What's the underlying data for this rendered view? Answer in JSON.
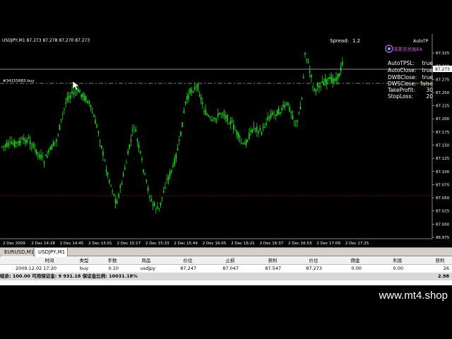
{
  "chart": {
    "symbol_info": "USDJPY,M1  87.273 87.278 87.270 87.273",
    "spread_label": "Spread:",
    "spread_value": "1.2",
    "autotp_label": "AutoTP",
    "logo_text": "浑茶东贸易EA",
    "order_label": "#34155883 buy",
    "current_price": "87.273",
    "price_ticks": [
      "87.325",
      "87.300",
      "87.275",
      "87.250",
      "87.225",
      "87.200",
      "87.175",
      "87.150",
      "87.125",
      "87.100",
      "87.075",
      "87.050",
      "87.025",
      "87.000",
      "86.975"
    ],
    "time_ticks": [
      "2 Dec 2009",
      "2 Dec 14:28",
      "2 Dec 14:45",
      "2 Dec 15:01",
      "2 Dec 15:17",
      "2 Dec 15:33",
      "2 Dec 15:49",
      "2 Dec 16:05",
      "2 Dec 16:21",
      "2 Dec 16:37",
      "2 Dec 16:53",
      "2 Dec 17:09",
      "2 Dec 17:25"
    ],
    "colors": {
      "candle": "#00ff00",
      "grid": "#000000",
      "ask_line": "#c0c0c0",
      "order_line": "#8bd40a",
      "stop_line": "#d21e1e",
      "text": "#ffffff"
    },
    "settings": [
      {
        "label": "AutoTPSL:",
        "value": "true"
      },
      {
        "label": "AutoClose:",
        "value": "true"
      },
      {
        "label": "DWBClose:",
        "value": "true"
      },
      {
        "label": "DWSClose:",
        "value": "false"
      },
      {
        "label": "TakeProfit:",
        "value": "30"
      },
      {
        "label": "StopLoss:",
        "value": "20"
      }
    ]
  },
  "tabs": [
    {
      "label": "EURUSD,M1"
    },
    {
      "label": "USDJPY,M1"
    }
  ],
  "table": {
    "headers": [
      "时间",
      "类型",
      "手数",
      "商品",
      "价位",
      "止损",
      "获利",
      "价位",
      "佣金",
      "利息",
      "获利"
    ],
    "order": [
      "2009.12.02 17:20",
      "buy",
      "0.10",
      "usdjpy",
      "87.247",
      "87.047",
      "87.547",
      "87.273",
      "0.00",
      "0.00",
      "26"
    ],
    "summary_text": "结余: 100.00  可用保证金: 9 931.18  保证金比例: 10031.18%",
    "summary_total": "2.98"
  },
  "watermark": "www.mt4.shop"
}
